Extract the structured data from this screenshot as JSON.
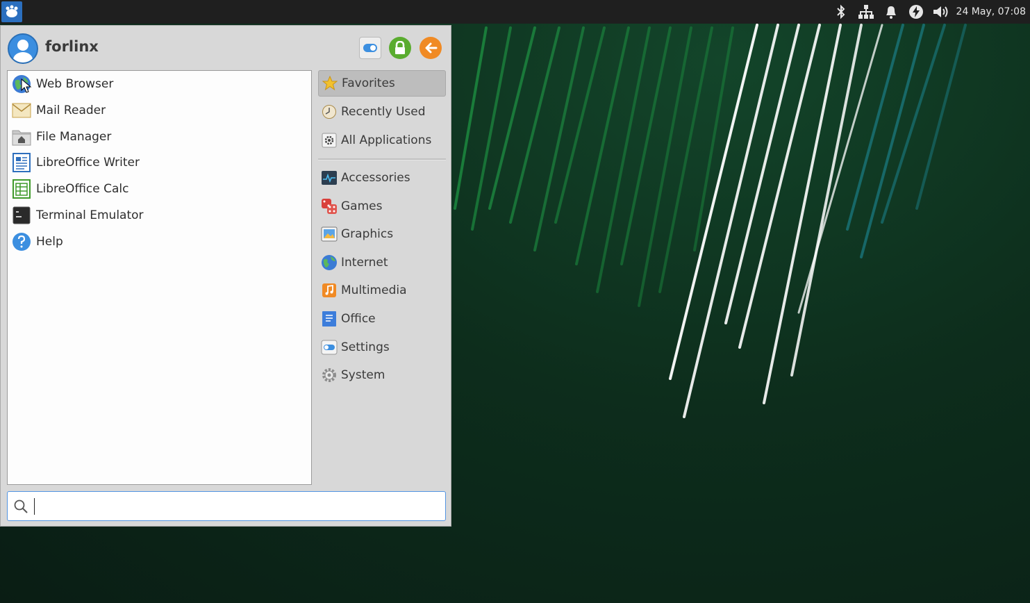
{
  "panel": {
    "clock": "24 May, 07:08",
    "tray_icons": [
      "bluetooth-icon",
      "network-icon",
      "notification-bell-icon",
      "power-manager-icon",
      "volume-icon"
    ]
  },
  "menu": {
    "username": "forlinx",
    "favorites": [
      {
        "label": "Web Browser",
        "icon": "web-browser-icon"
      },
      {
        "label": "Mail Reader",
        "icon": "mail-reader-icon"
      },
      {
        "label": "File Manager",
        "icon": "file-manager-icon"
      },
      {
        "label": "LibreOffice Writer",
        "icon": "libreoffice-writer-icon"
      },
      {
        "label": "LibreOffice Calc",
        "icon": "libreoffice-calc-icon"
      },
      {
        "label": "Terminal Emulator",
        "icon": "terminal-icon"
      },
      {
        "label": "Help",
        "icon": "help-icon"
      }
    ],
    "categories_top": [
      {
        "label": "Favorites",
        "icon": "star-icon",
        "active": true
      },
      {
        "label": "Recently Used",
        "icon": "clock-icon"
      },
      {
        "label": "All Applications",
        "icon": "gear-icon"
      }
    ],
    "categories": [
      {
        "label": "Accessories",
        "icon": "accessories-icon"
      },
      {
        "label": "Games",
        "icon": "dice-icon"
      },
      {
        "label": "Graphics",
        "icon": "graphics-icon"
      },
      {
        "label": "Internet",
        "icon": "globe-icon"
      },
      {
        "label": "Multimedia",
        "icon": "music-icon"
      },
      {
        "label": "Office",
        "icon": "office-icon"
      },
      {
        "label": "Settings",
        "icon": "settings-toggle-icon"
      },
      {
        "label": "System",
        "icon": "system-gear-icon"
      }
    ],
    "search": {
      "value": "",
      "placeholder": ""
    }
  },
  "colors": {
    "accent": "#5294e2",
    "panel_bg": "#1f1f1f",
    "menu_bg": "#d8d8d8",
    "desktop_green": "#0d2d1c"
  }
}
